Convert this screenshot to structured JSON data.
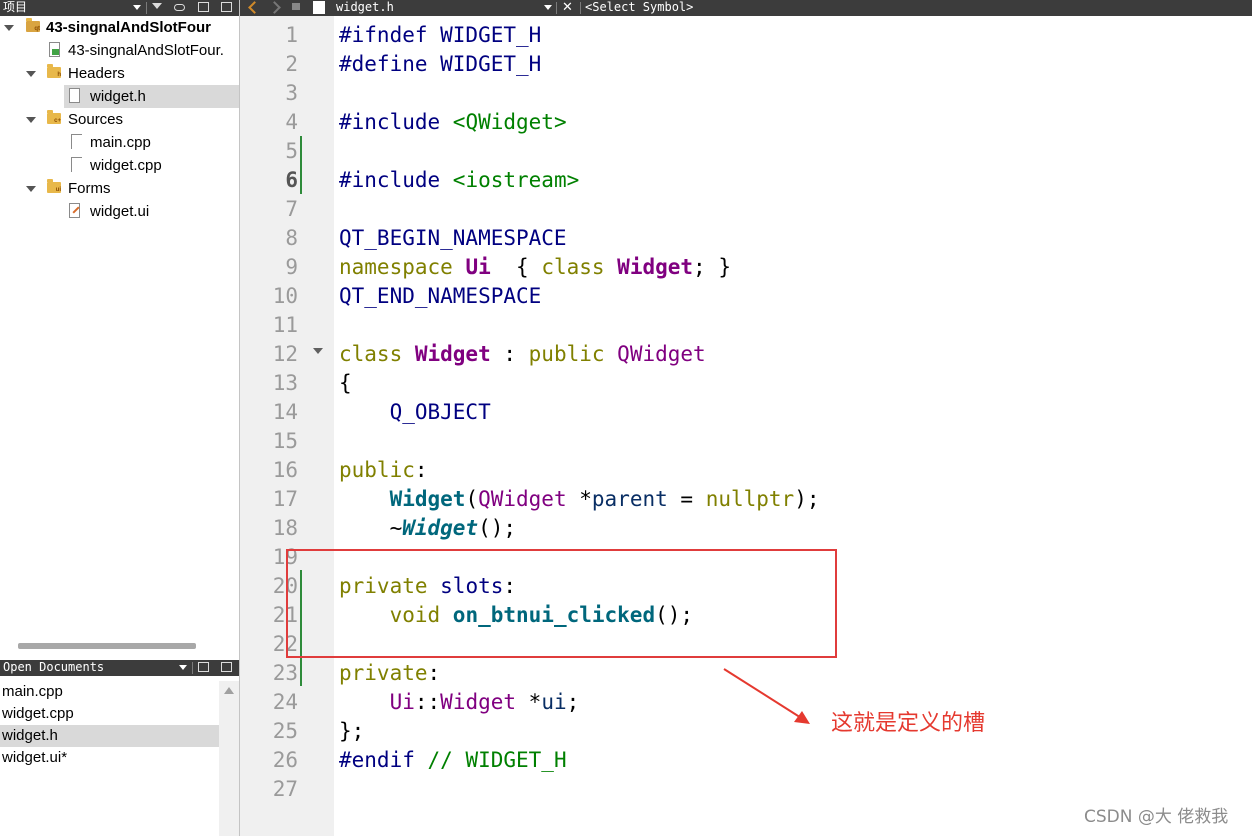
{
  "project_panel": {
    "title": "项目",
    "tree": [
      {
        "label": "43-singnalAndSlotFour",
        "kind": "project"
      },
      {
        "label": "43-singnalAndSlotFour.",
        "kind": "pro-file"
      },
      {
        "label": "Headers",
        "kind": "folder"
      },
      {
        "label": "widget.h",
        "kind": "file",
        "selected": true
      },
      {
        "label": "Sources",
        "kind": "folder"
      },
      {
        "label": "main.cpp",
        "kind": "file"
      },
      {
        "label": "widget.cpp",
        "kind": "file"
      },
      {
        "label": "Forms",
        "kind": "folder"
      },
      {
        "label": "widget.ui",
        "kind": "ui-file"
      }
    ]
  },
  "open_documents": {
    "title": "Open Documents",
    "items": [
      "main.cpp",
      "widget.cpp",
      "widget.h",
      "widget.ui*"
    ],
    "selected": "widget.h"
  },
  "editor": {
    "filename": "widget.h",
    "symbol_selector": "<Select Symbol>",
    "current_line": 6,
    "line_numbers": [
      "1",
      "2",
      "3",
      "4",
      "5",
      "6",
      "7",
      "8",
      "9",
      "10",
      "11",
      "12",
      "13",
      "14",
      "15",
      "16",
      "17",
      "18",
      "19",
      "20",
      "21",
      "22",
      "23",
      "24",
      "25",
      "26",
      "27"
    ],
    "code": [
      [
        [
          "pp",
          "#ifndef WIDGET_H"
        ]
      ],
      [
        [
          "pp",
          "#define WIDGET_H"
        ]
      ],
      [],
      [
        [
          "pp",
          "#include "
        ],
        [
          "inc",
          "<QWidget>"
        ]
      ],
      [],
      [
        [
          "pp",
          "#include "
        ],
        [
          "inc",
          "<iostream>"
        ]
      ],
      [],
      [
        [
          "mac",
          "QT_BEGIN_NAMESPACE"
        ]
      ],
      [
        [
          "kw",
          "namespace "
        ],
        [
          "cls",
          "Ui"
        ],
        [
          "",
          "  { "
        ],
        [
          "kw",
          "class "
        ],
        [
          "cls",
          "Widget"
        ],
        [
          "",
          "; }"
        ]
      ],
      [
        [
          "mac",
          "QT_END_NAMESPACE"
        ]
      ],
      [],
      [
        [
          "kw",
          "class "
        ],
        [
          "cls",
          "Widget"
        ],
        [
          "",
          " : "
        ],
        [
          "kw",
          "public "
        ],
        [
          "typ",
          "QWidget"
        ]
      ],
      [
        [
          "",
          "{"
        ]
      ],
      [
        [
          "",
          "    "
        ],
        [
          "mac",
          "Q_OBJECT"
        ]
      ],
      [],
      [
        [
          "kw",
          "public"
        ],
        [
          "",
          ":"
        ]
      ],
      [
        [
          "",
          "    "
        ],
        [
          "fn",
          "Widget"
        ],
        [
          "",
          "("
        ],
        [
          "typ",
          "QWidget"
        ],
        [
          "",
          " *"
        ],
        [
          "var",
          "parent"
        ],
        [
          "",
          " = "
        ],
        [
          "kw",
          "nullptr"
        ],
        [
          "",
          ");"
        ]
      ],
      [
        [
          "",
          "    ~"
        ],
        [
          "fni",
          "Widget"
        ],
        [
          "",
          "();"
        ]
      ],
      [],
      [
        [
          "kw",
          "private "
        ],
        [
          "pp",
          "slots"
        ],
        [
          "",
          ":"
        ]
      ],
      [
        [
          "",
          "    "
        ],
        [
          "kw",
          "void "
        ],
        [
          "fn",
          "on_btnui_clicked"
        ],
        [
          "",
          "();"
        ]
      ],
      [],
      [
        [
          "kw",
          "private"
        ],
        [
          "",
          ":"
        ]
      ],
      [
        [
          "",
          "    "
        ],
        [
          "typ",
          "Ui"
        ],
        [
          "",
          "::"
        ],
        [
          "typ",
          "Widget"
        ],
        [
          "",
          " *"
        ],
        [
          "var",
          "ui"
        ],
        [
          "",
          ";"
        ]
      ],
      [
        [
          "",
          "};"
        ]
      ],
      [
        [
          "pp",
          "#endif "
        ],
        [
          "cm",
          "// WIDGET_H"
        ]
      ],
      []
    ]
  },
  "annotation": {
    "text": "这就是定义的槽",
    "color": "#e5392f"
  },
  "watermark": "CSDN @大 佬救我",
  "colors": {
    "keyword": "#808000",
    "preprocessor": "#000080",
    "include": "#008000",
    "class": "#800080",
    "function": "#00677c",
    "highlight_box": "#e03c3c"
  }
}
